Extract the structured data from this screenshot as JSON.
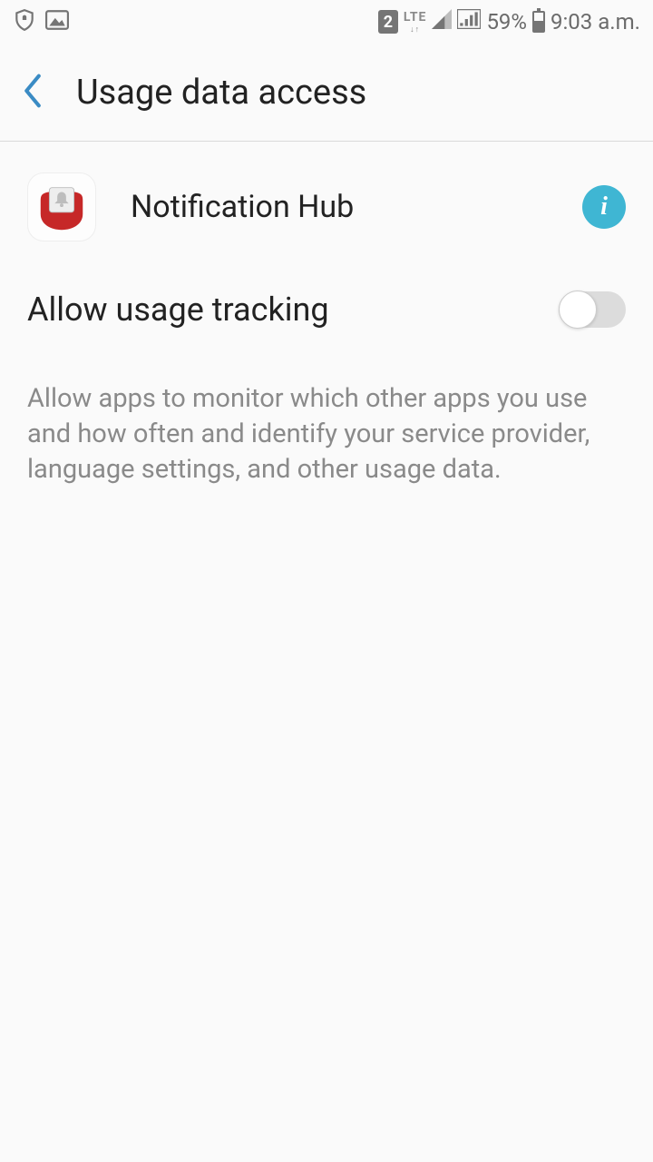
{
  "status": {
    "sim": "2",
    "net": "LTE",
    "battery_pct": "59%",
    "time": "9:03 a.m."
  },
  "header": {
    "title": "Usage data access"
  },
  "app": {
    "name": "Notification Hub",
    "info_glyph": "i"
  },
  "setting": {
    "label": "Allow usage tracking",
    "enabled": false,
    "description": "Allow apps to monitor which other apps you use and how often and identify your service provider, language settings, and other usage data."
  }
}
